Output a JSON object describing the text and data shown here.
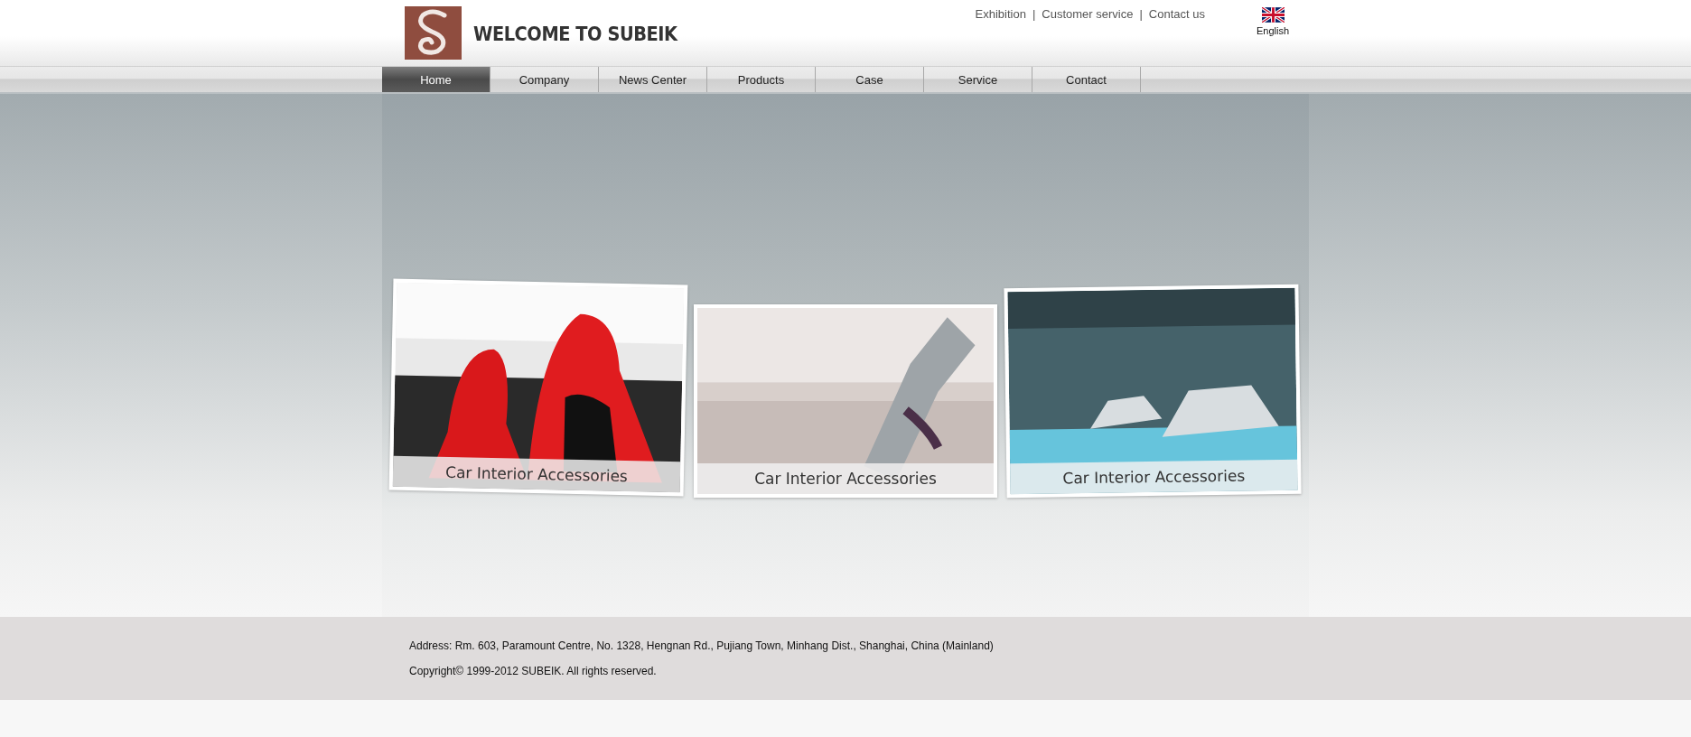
{
  "header": {
    "site_title": "WELCOME TO SUBEIK",
    "top_links": [
      "Exhibition",
      "Customer service",
      "Contact us"
    ],
    "link_separator": "|",
    "language": "English"
  },
  "nav": [
    {
      "label": "Home",
      "selected": true
    },
    {
      "label": "Company",
      "selected": false
    },
    {
      "label": "News Center",
      "selected": false
    },
    {
      "label": "Products",
      "selected": false
    },
    {
      "label": "Case",
      "selected": false
    },
    {
      "label": "Service",
      "selected": false
    },
    {
      "label": "Contact",
      "selected": false
    }
  ],
  "showcase": [
    {
      "kind": "seats",
      "caption": "Car Interior Accessories"
    },
    {
      "kind": "tool",
      "caption": "Car Interior Accessories"
    },
    {
      "kind": "factory",
      "caption": "Car Interior Accessories"
    }
  ],
  "footer": {
    "address": "Address: Rm. 603, Paramount Centre, No. 1328, Hengnan Rd., Pujiang Town, Minhang Dist., Shanghai, China (Mainland)",
    "copyright": "Copyright© 1999-2012 SUBEIK. All rights reserved."
  }
}
